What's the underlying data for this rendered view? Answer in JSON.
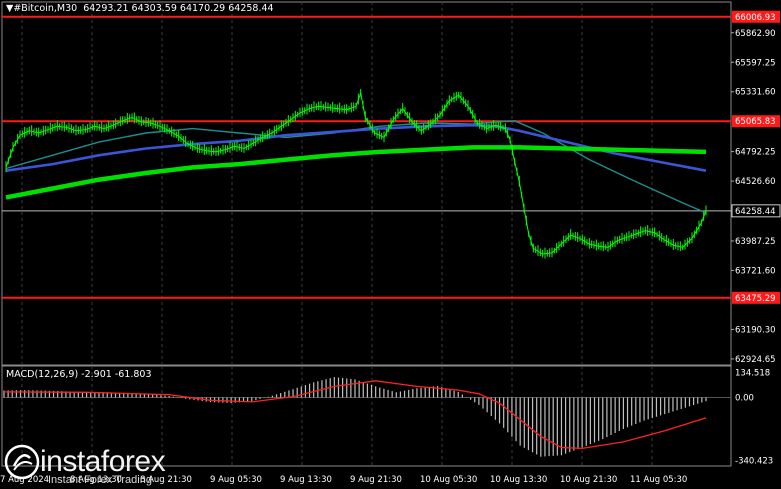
{
  "header": {
    "symbol": "#Bitcoin,M30",
    "ohlc": "64293.21 64303.59 64170.29 64258.44"
  },
  "macd": {
    "label": "MACD(12,26,9) -2.901 -61.803"
  },
  "branding": {
    "logo": "instaforex",
    "tagline": "Instant Forex Trading"
  },
  "colors": {
    "background": "#000000",
    "candle": "#00ff00",
    "ma_fast": "#1b8f8f",
    "ma_mid": "#3a56d6",
    "ma_slow": "#00e000",
    "level_line": "#ff1a1a",
    "macd_hist": "#c0c0c0",
    "macd_signal": "#ff2020",
    "grid": "#3c3c3c"
  },
  "chart_data": {
    "type": "line",
    "price_axis": {
      "ticks": [
        "65862.90",
        "65597.25",
        "65331.60",
        "64792.25",
        "64526.60",
        "63987.25",
        "63721.60",
        "63190.30",
        "62924.65"
      ],
      "tick_values": [
        65862.9,
        65597.25,
        65331.6,
        64792.25,
        64526.6,
        63987.25,
        63721.6,
        63190.3,
        62924.65
      ],
      "ylim": [
        62870,
        66140
      ]
    },
    "time_axis": {
      "labels": [
        "7 Aug 2024",
        "8 Aug 13:30",
        "8 Aug 21:30",
        "9 Aug 05:30",
        "9 Aug 13:30",
        "9 Aug 21:30",
        "10 Aug 05:30",
        "10 Aug 13:30",
        "10 Aug 21:30",
        "11 Aug 05:30"
      ],
      "bar_index": [
        0,
        30,
        60,
        90,
        120,
        150,
        180,
        210,
        240,
        270
      ],
      "total_bars": 300
    },
    "levels": [
      {
        "label": "66006.93",
        "value": 66006.93
      },
      {
        "label": "65065.83",
        "value": 65065.83
      },
      {
        "label": "63475.29",
        "value": 63475.29
      }
    ],
    "current_price": {
      "label": "64258.44",
      "value": 64258.44
    },
    "price": [
      [
        0,
        64650
      ],
      [
        3,
        64830
      ],
      [
        6,
        64940
      ],
      [
        10,
        64980
      ],
      [
        14,
        64960
      ],
      [
        18,
        64990
      ],
      [
        22,
        65020
      ],
      [
        26,
        65010
      ],
      [
        30,
        64980
      ],
      [
        34,
        64990
      ],
      [
        38,
        65020
      ],
      [
        42,
        65000
      ],
      [
        46,
        65030
      ],
      [
        50,
        65070
      ],
      [
        54,
        65100
      ],
      [
        58,
        65060
      ],
      [
        62,
        65050
      ],
      [
        66,
        65020
      ],
      [
        70,
        64980
      ],
      [
        74,
        64930
      ],
      [
        78,
        64860
      ],
      [
        82,
        64820
      ],
      [
        86,
        64800
      ],
      [
        90,
        64790
      ],
      [
        94,
        64810
      ],
      [
        98,
        64840
      ],
      [
        102,
        64820
      ],
      [
        106,
        64870
      ],
      [
        110,
        64920
      ],
      [
        114,
        64960
      ],
      [
        118,
        65020
      ],
      [
        122,
        65080
      ],
      [
        126,
        65140
      ],
      [
        130,
        65180
      ],
      [
        134,
        65200
      ],
      [
        138,
        65190
      ],
      [
        142,
        65180
      ],
      [
        146,
        65170
      ],
      [
        150,
        65200
      ],
      [
        152,
        65320
      ],
      [
        154,
        65100
      ],
      [
        158,
        64960
      ],
      [
        162,
        64920
      ],
      [
        166,
        65080
      ],
      [
        170,
        65180
      ],
      [
        174,
        65060
      ],
      [
        178,
        64980
      ],
      [
        182,
        65040
      ],
      [
        186,
        65120
      ],
      [
        190,
        65250
      ],
      [
        194,
        65300
      ],
      [
        198,
        65200
      ],
      [
        202,
        65050
      ],
      [
        206,
        65000
      ],
      [
        210,
        65030
      ],
      [
        214,
        65000
      ],
      [
        216,
        64900
      ],
      [
        218,
        64700
      ],
      [
        220,
        64520
      ],
      [
        222,
        64280
      ],
      [
        224,
        64050
      ],
      [
        226,
        63920
      ],
      [
        230,
        63870
      ],
      [
        234,
        63880
      ],
      [
        238,
        63960
      ],
      [
        242,
        64040
      ],
      [
        246,
        64010
      ],
      [
        250,
        63960
      ],
      [
        254,
        63940
      ],
      [
        258,
        63930
      ],
      [
        262,
        63990
      ],
      [
        266,
        64020
      ],
      [
        270,
        64050
      ],
      [
        274,
        64080
      ],
      [
        278,
        64060
      ],
      [
        282,
        64000
      ],
      [
        286,
        63950
      ],
      [
        290,
        63930
      ],
      [
        294,
        64010
      ],
      [
        298,
        64150
      ],
      [
        300,
        64258
      ]
    ],
    "series": [
      {
        "values": [
          [
            0,
            64640
          ],
          [
            20,
            64760
          ],
          [
            40,
            64880
          ],
          [
            60,
            64960
          ],
          [
            80,
            65000
          ],
          [
            100,
            64960
          ],
          [
            120,
            64920
          ],
          [
            140,
            64960
          ],
          [
            160,
            65020
          ],
          [
            180,
            65050
          ],
          [
            200,
            65040
          ],
          [
            210,
            65060
          ],
          [
            218,
            65070
          ],
          [
            230,
            64960
          ],
          [
            250,
            64720
          ],
          [
            270,
            64520
          ],
          [
            290,
            64330
          ],
          [
            300,
            64240
          ]
        ]
      },
      {
        "values": [
          [
            0,
            64620
          ],
          [
            20,
            64680
          ],
          [
            40,
            64760
          ],
          [
            60,
            64820
          ],
          [
            80,
            64860
          ],
          [
            100,
            64890
          ],
          [
            120,
            64940
          ],
          [
            140,
            64970
          ],
          [
            160,
            65000
          ],
          [
            180,
            65020
          ],
          [
            200,
            65030
          ],
          [
            210,
            65020
          ],
          [
            220,
            64980
          ],
          [
            240,
            64880
          ],
          [
            260,
            64780
          ],
          [
            280,
            64700
          ],
          [
            300,
            64620
          ]
        ]
      },
      {
        "values": [
          [
            0,
            64380
          ],
          [
            20,
            64460
          ],
          [
            40,
            64540
          ],
          [
            60,
            64600
          ],
          [
            80,
            64650
          ],
          [
            100,
            64680
          ],
          [
            120,
            64720
          ],
          [
            140,
            64760
          ],
          [
            160,
            64790
          ],
          [
            180,
            64810
          ],
          [
            200,
            64830
          ],
          [
            220,
            64830
          ],
          [
            240,
            64820
          ],
          [
            260,
            64810
          ],
          [
            280,
            64800
          ],
          [
            300,
            64790
          ]
        ]
      }
    ],
    "macd_axis": {
      "ticks": [
        "134.518",
        "0.00",
        "-340.423"
      ],
      "tick_values": [
        134.518,
        0,
        -340.423
      ],
      "ylim": [
        -370,
        170
      ]
    },
    "macd_hist": [
      [
        0,
        38
      ],
      [
        10,
        40
      ],
      [
        20,
        37
      ],
      [
        30,
        33
      ],
      [
        40,
        30
      ],
      [
        50,
        28
      ],
      [
        60,
        25
      ],
      [
        70,
        18
      ],
      [
        80,
        8
      ],
      [
        90,
        -10
      ],
      [
        100,
        -25
      ],
      [
        110,
        -30
      ],
      [
        120,
        -20
      ],
      [
        130,
        10
      ],
      [
        140,
        45
      ],
      [
        150,
        82
      ],
      [
        160,
        110
      ],
      [
        170,
        98
      ],
      [
        180,
        60
      ],
      [
        190,
        28
      ],
      [
        200,
        50
      ],
      [
        210,
        62
      ],
      [
        220,
        30
      ],
      [
        230,
        -40
      ],
      [
        240,
        -140
      ],
      [
        250,
        -260
      ],
      [
        260,
        -320
      ],
      [
        270,
        -312
      ],
      [
        280,
        -270
      ],
      [
        290,
        -225
      ],
      [
        300,
        -170
      ],
      [
        310,
        -125
      ],
      [
        320,
        -90
      ],
      [
        330,
        -55
      ],
      [
        340,
        -20
      ]
    ],
    "macd_signal": [
      [
        0,
        30
      ],
      [
        40,
        28
      ],
      [
        80,
        15
      ],
      [
        100,
        -15
      ],
      [
        120,
        -24
      ],
      [
        140,
        5
      ],
      [
        160,
        60
      ],
      [
        180,
        90
      ],
      [
        200,
        60
      ],
      [
        220,
        40
      ],
      [
        230,
        20
      ],
      [
        240,
        -30
      ],
      [
        250,
        -120
      ],
      [
        260,
        -210
      ],
      [
        270,
        -270
      ],
      [
        280,
        -275
      ],
      [
        300,
        -240
      ],
      [
        320,
        -180
      ],
      [
        340,
        -110
      ]
    ]
  }
}
